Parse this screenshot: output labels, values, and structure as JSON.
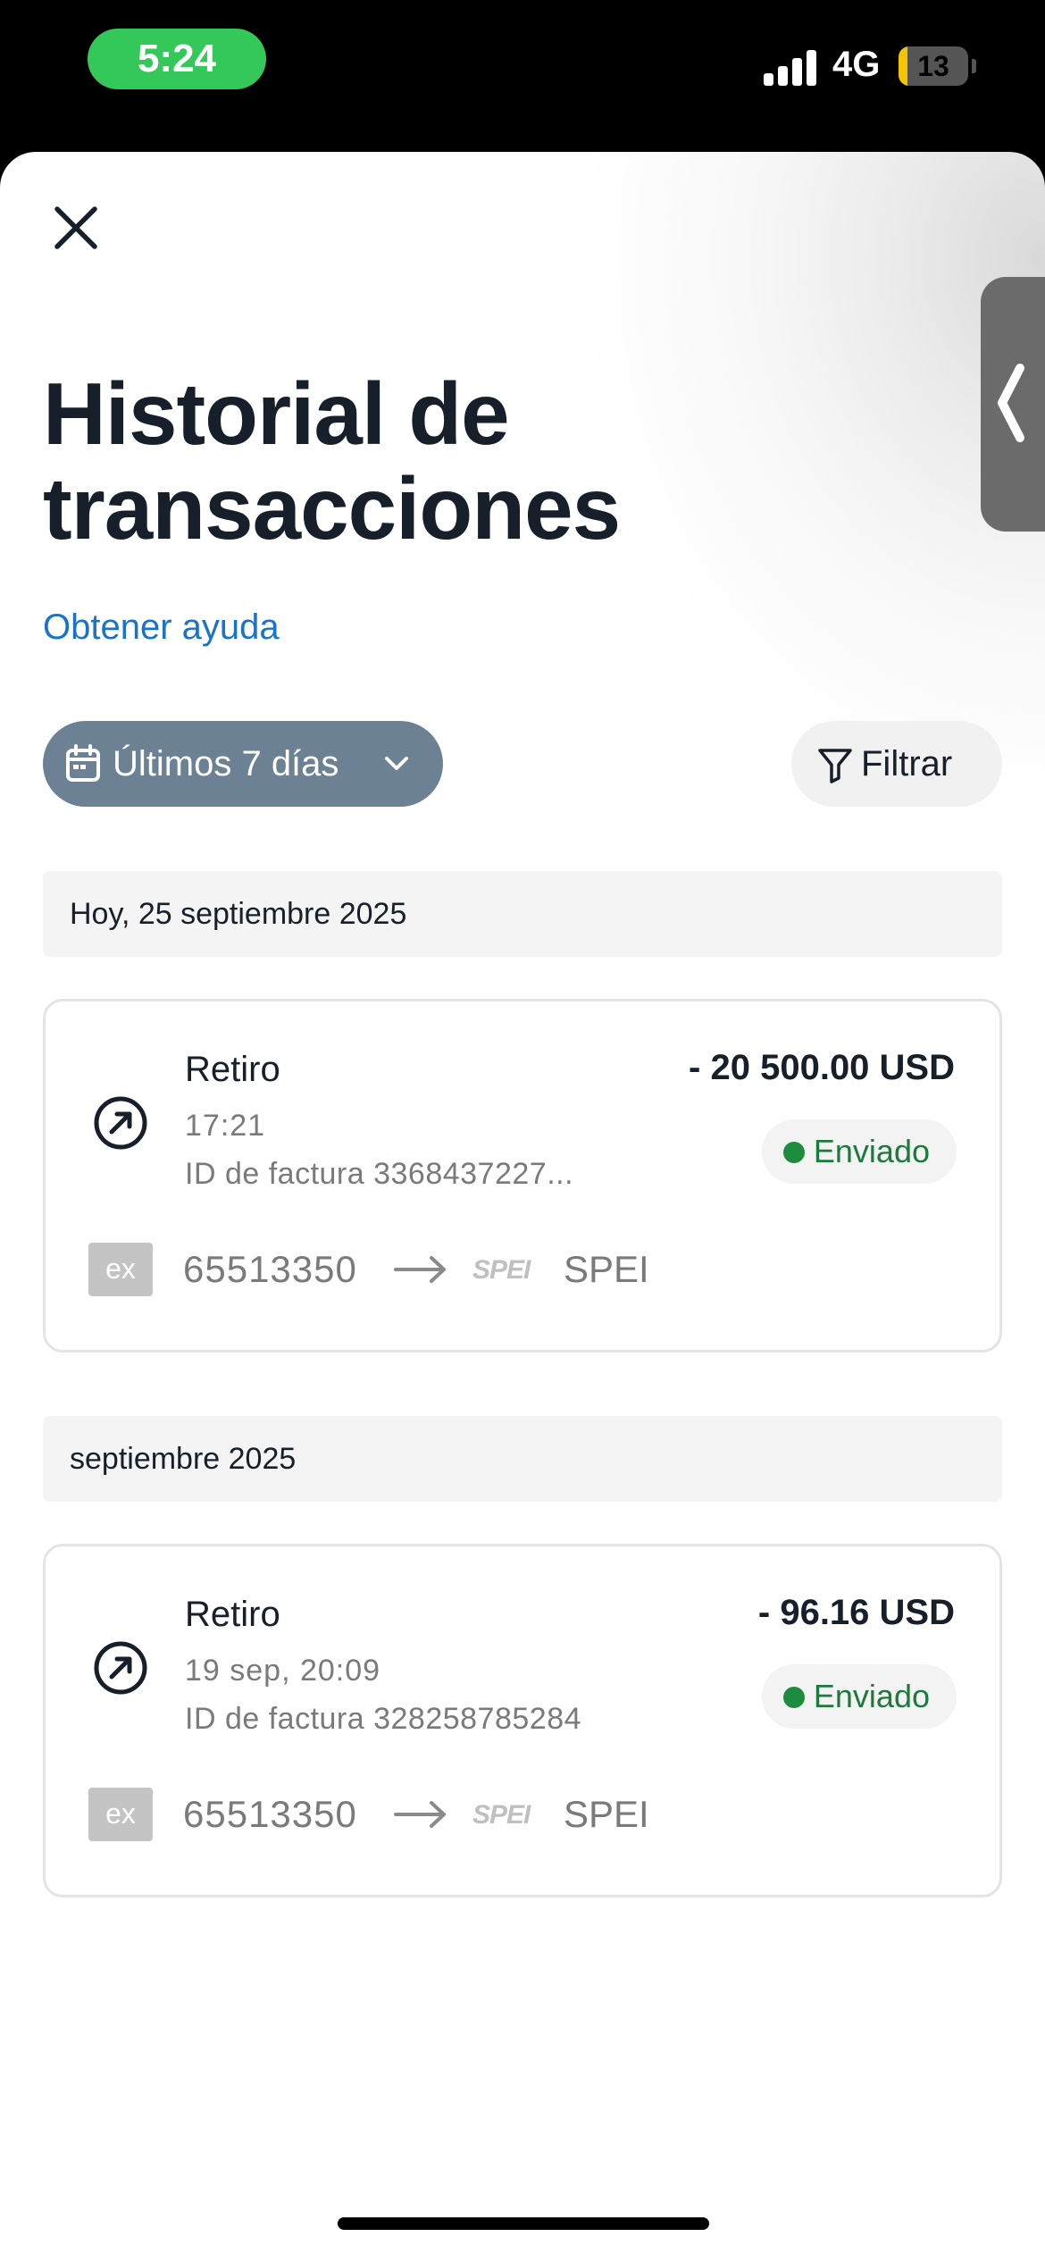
{
  "status_bar": {
    "time": "5:24",
    "network": "4G",
    "battery": "13"
  },
  "header": {
    "title": "Historial de transacciones",
    "help_link": "Obtener ayuda"
  },
  "filters": {
    "period_label": "Últimos 7 días",
    "filter_label": "Filtrar"
  },
  "groups": [
    {
      "date_label": "Hoy, 25 septiembre 2025",
      "transaction": {
        "type": "Retiro",
        "time": "17:21",
        "invoice": "ID de factura 3368437227...",
        "amount": "- 20 500.00 USD",
        "status": "Enviado",
        "source_logo": "ex",
        "source_account": "65513350",
        "dest_logo": "SPEI",
        "dest_name": "SPEI"
      }
    },
    {
      "date_label": "septiembre 2025",
      "transaction": {
        "type": "Retiro",
        "time": "19 sep, 20:09",
        "invoice": "ID de factura 328258785284",
        "amount": "- 96.16 USD",
        "status": "Enviado",
        "source_logo": "ex",
        "source_account": "65513350",
        "dest_logo": "SPEI",
        "dest_name": "SPEI"
      }
    }
  ],
  "icons": {
    "close": "close-icon",
    "side_tab": "chevron-left-icon",
    "period": "calendar-icon",
    "period_toggle": "chevron-down-icon",
    "filter": "filter-icon",
    "transaction": "arrow-up-right-circle-icon",
    "transfer": "arrow-right-icon"
  },
  "colors": {
    "accent_link": "#1a73c7",
    "period_button": "#6c8193",
    "status_sent": "#1e7a3c",
    "status_time_pill": "#34c759",
    "title_text": "#17202a"
  }
}
